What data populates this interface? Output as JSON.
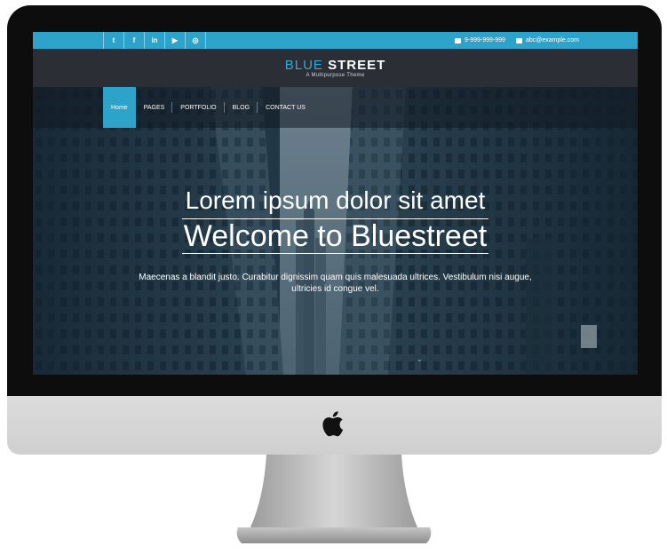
{
  "topbar": {
    "social_icons": [
      "twitter-icon",
      "facebook-icon",
      "linkedin-icon",
      "youtube-icon",
      "instagram-icon"
    ],
    "social_glyphs": [
      "t",
      "f",
      "in",
      "▶",
      "◎"
    ],
    "phone": "9-999-999-999",
    "email": "abc@example.com"
  },
  "header": {
    "logo_part1": "BLUE",
    "logo_part2": "STREET",
    "tagline": "A Multipurpose Theme"
  },
  "nav": {
    "items": [
      "Home",
      "PAGES",
      "PORTFOLIO",
      "BLOG",
      "CONTACT US"
    ],
    "active": "Home"
  },
  "hero": {
    "title": "Lorem ipsum dolor sit amet",
    "subtitle": "Welcome to Bluestreet",
    "paragraph": "Maecenas a blandit justo. Curabitur dignissim quam quis malesuada ultrices. Vestibulum nisi augue, ultricies id congue vel."
  },
  "colors": {
    "accent": "#2ea3c9",
    "header_bg": "#2b2f35",
    "bezel": "#0d0d0d"
  }
}
